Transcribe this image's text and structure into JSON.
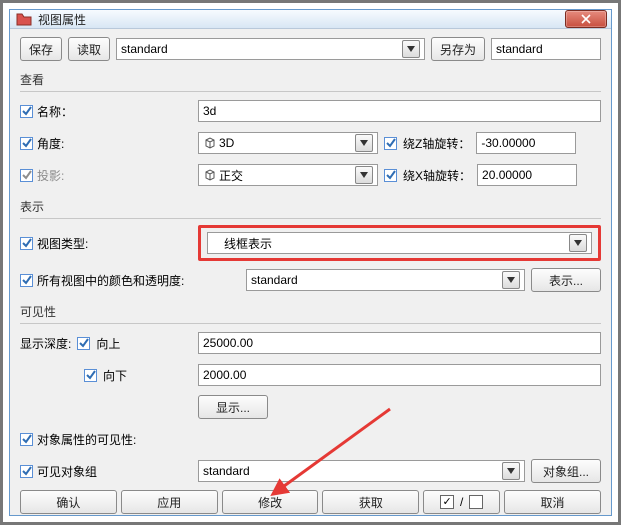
{
  "title": "视图属性",
  "toprow": {
    "save": "保存",
    "load": "读取",
    "preset_value": "standard",
    "saveas": "另存为",
    "saveas_value": "standard"
  },
  "sections": {
    "view": "查看",
    "display": "表示",
    "visibility": "可见性"
  },
  "view": {
    "name_label": "名称：",
    "name_value": "3d",
    "angle_label": "角度:",
    "angle_value": "3D",
    "rotz_label": "绕Z轴旋转：",
    "rotz_value": "-30.00000",
    "proj_label": "投影:",
    "proj_value": "正交",
    "rotx_label": "绕X轴旋转：",
    "rotx_value": "20.00000"
  },
  "display": {
    "viewtype_label": "视图类型:",
    "viewtype_value": "线框表示",
    "allcolors_label": "所有视图中的颜色和透明度:",
    "allcolors_value": "standard",
    "repr_btn": "表示..."
  },
  "visibility": {
    "depth_label": "显示深度:",
    "up_label": "向上",
    "up_value": "25000.00",
    "down_label": "向下",
    "down_value": "2000.00",
    "show_btn": "显示...",
    "objattr_label": "对象属性的可见性:",
    "visgroup_label": "可见对象组",
    "visgroup_value": "standard",
    "objgroup_btn": "对象组..."
  },
  "bottom": {
    "ok": "确认",
    "apply": "应用",
    "modify": "修改",
    "get": "获取",
    "cancel": "取消"
  }
}
